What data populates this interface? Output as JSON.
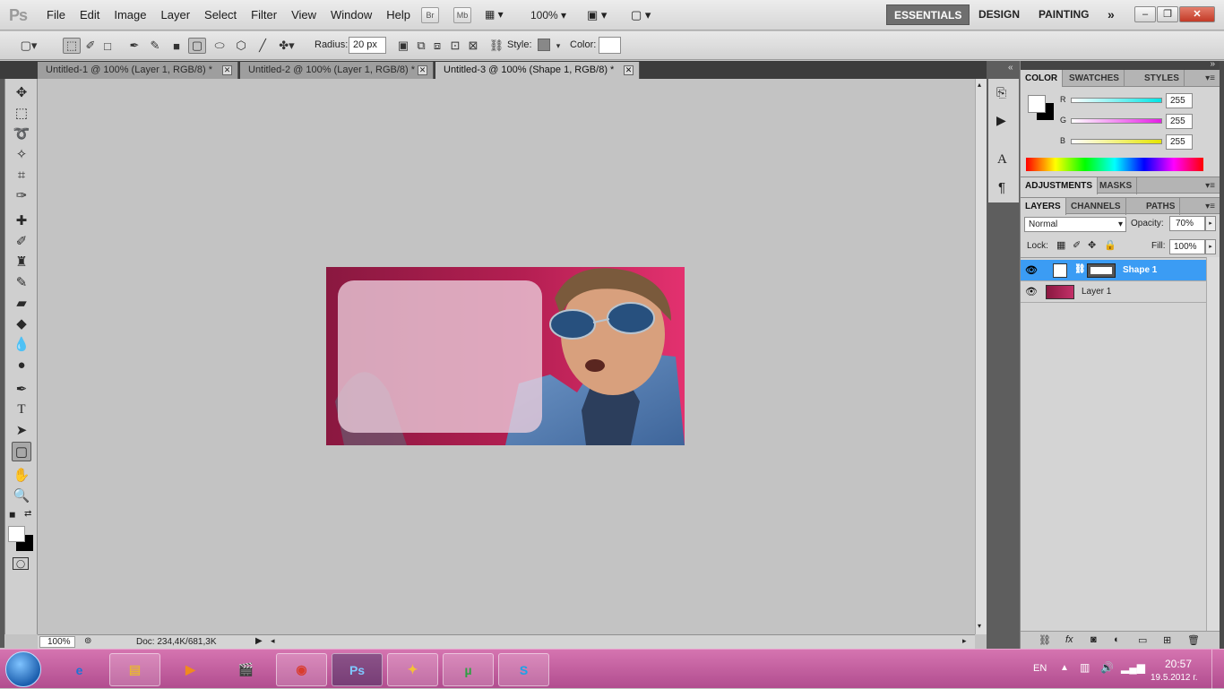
{
  "app": {
    "logo": "Ps"
  },
  "menu": [
    "File",
    "Edit",
    "Image",
    "Layer",
    "Select",
    "Filter",
    "View",
    "Window",
    "Help"
  ],
  "app_bar": {
    "bridge": "Br",
    "minibridge": "Mb",
    "zoom": "100%"
  },
  "workspaces": {
    "active": "ESSENTIALS",
    "items": [
      "DESIGN",
      "PAINTING"
    ],
    "more": "»"
  },
  "options": {
    "radius_label": "Radius:",
    "radius_value": "20 px",
    "style_label": "Style:",
    "color_label": "Color:"
  },
  "tabs": [
    {
      "label": "Untitled-1 @ 100% (Layer 1, RGB/8) *"
    },
    {
      "label": "Untitled-2 @ 100% (Layer 1, RGB/8) *"
    },
    {
      "label": "Untitled-3 @ 100% (Shape 1, RGB/8) *"
    }
  ],
  "status": {
    "zoom": "100%",
    "doc": "Doc: 234,4K/681,3K"
  },
  "color_panel": {
    "tabs": [
      "COLOR",
      "SWATCHES",
      "STYLES"
    ],
    "r_label": "R",
    "g_label": "G",
    "b_label": "B",
    "r": "255",
    "g": "255",
    "b": "255",
    "r_color": "#00e5e5",
    "g_color": "#e51de5",
    "b_color": "#e5e500"
  },
  "adjust_panel": {
    "tabs": [
      "ADJUSTMENTS",
      "MASKS"
    ]
  },
  "layers_panel": {
    "tabs": [
      "LAYERS",
      "CHANNELS",
      "PATHS"
    ],
    "blend": "Normal",
    "opacity_label": "Opacity:",
    "opacity": "70%",
    "lock_label": "Lock:",
    "fill_label": "Fill:",
    "fill": "100%",
    "layers": [
      {
        "name": "Shape 1"
      },
      {
        "name": "Layer 1"
      }
    ]
  },
  "taskbar": {
    "lang": "EN",
    "time": "20:57",
    "date": "19.5.2012 г."
  },
  "colors": {
    "accent_selection": "#3b9cf4",
    "taskbar": "#c25fa0",
    "image_bg": "#a81e4f"
  }
}
